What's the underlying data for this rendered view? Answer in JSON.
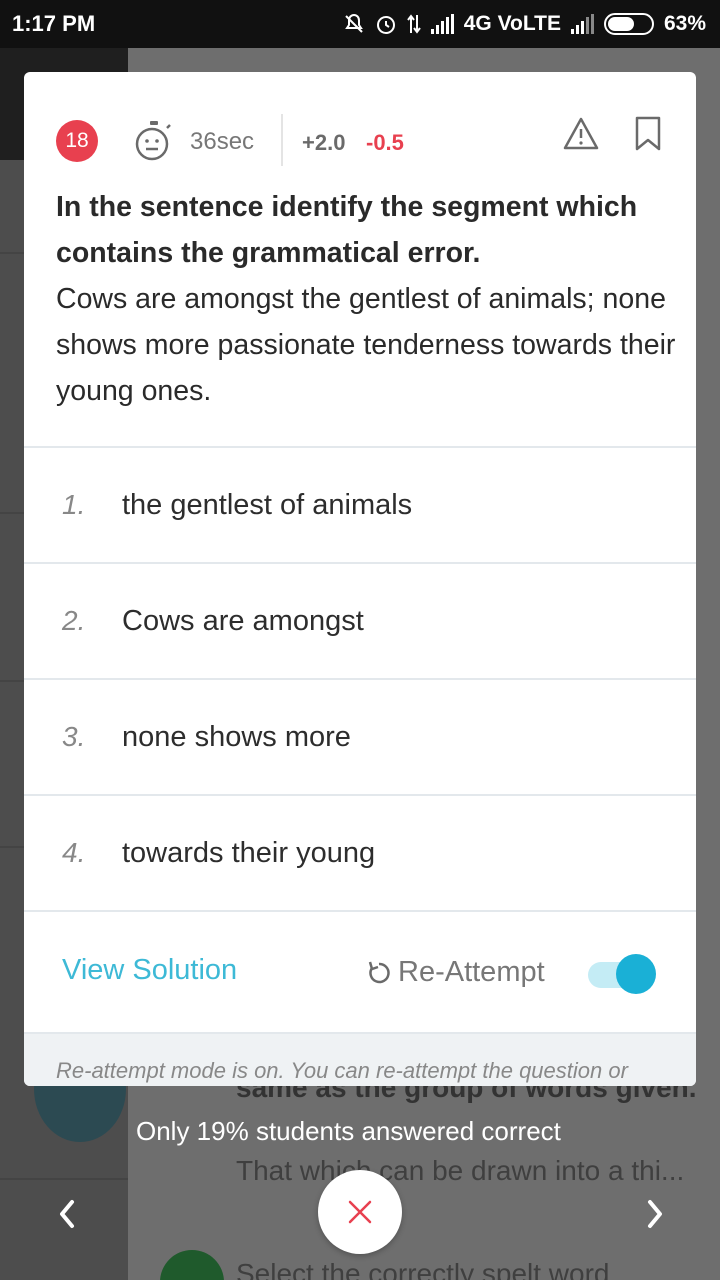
{
  "status_bar": {
    "time": "1:17 PM",
    "network": "4G VoLTE",
    "battery": "63%",
    "battery_level": 0.63
  },
  "question_header": {
    "number": "18",
    "timer": "36sec",
    "positive_marks": "+2.0",
    "negative_marks": "-0.5",
    "icons": [
      "timer-icon",
      "warning-icon",
      "bookmark-icon"
    ]
  },
  "question": {
    "prompt": "In the sentence identify the segment which contains the grammatical error.",
    "sentence": "Cows are amongst the gentlest of animals; none shows more passionate tenderness towards their young ones."
  },
  "options": [
    {
      "num": "1.",
      "text": "the gentlest of animals"
    },
    {
      "num": "2.",
      "text": "Cows are amongst"
    },
    {
      "num": "3.",
      "text": "none shows more"
    },
    {
      "num": "4.",
      "text": "towards their young"
    }
  ],
  "actions": {
    "view_solution": "View Solution",
    "reattempt": "Re-Attempt",
    "reattempt_toggle_on": true
  },
  "info_text": "Re-attempt mode is on. You can re-attempt the question or",
  "stats_text": "Only 19% students answered correct",
  "background": {
    "partial_line_1": "same as the group of words given.",
    "partial_line_2": "That which can be drawn into a thi...",
    "partial_line_3": "Select the correctly spelt word"
  },
  "colors": {
    "accent": "#3db9d6",
    "badge": "#e8404f",
    "negative": "#e8404f",
    "toggle": "#1ab0d6"
  }
}
